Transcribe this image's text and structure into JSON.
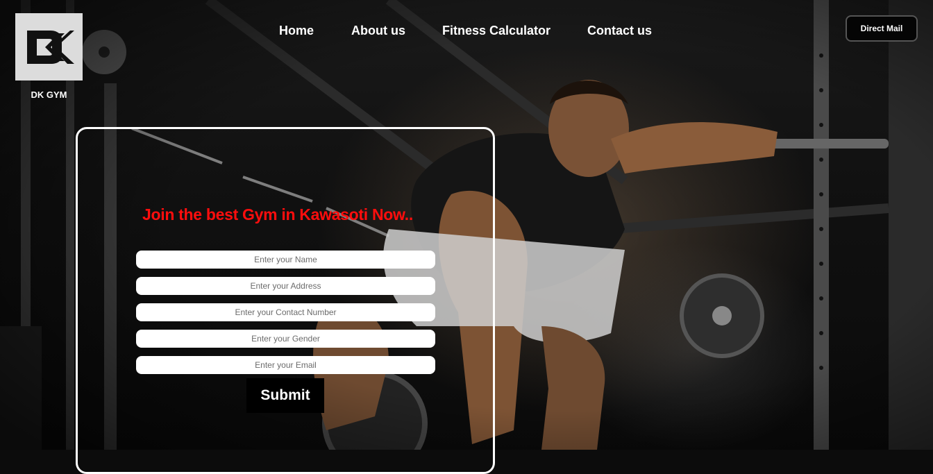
{
  "brand": {
    "logo_name": "dk-logo-icon",
    "caption": "DK GYM"
  },
  "nav": {
    "home": "Home",
    "about": "About us",
    "fitness": "Fitness Calculator",
    "contact": "Contact us"
  },
  "header": {
    "direct_mail": "Direct Mail"
  },
  "form": {
    "headline": "Join the best Gym in Kawasoti Now..",
    "headline_color": "#ff0d0d",
    "name_placeholder": "Enter your Name",
    "address_placeholder": "Enter your Address",
    "contact_placeholder": "Enter your Contact Number",
    "gender_placeholder": "Enter your Gender",
    "email_placeholder": "Enter your Email",
    "submit_label": "Submit"
  },
  "background": {
    "description_icon": "gym-athlete-photo"
  }
}
